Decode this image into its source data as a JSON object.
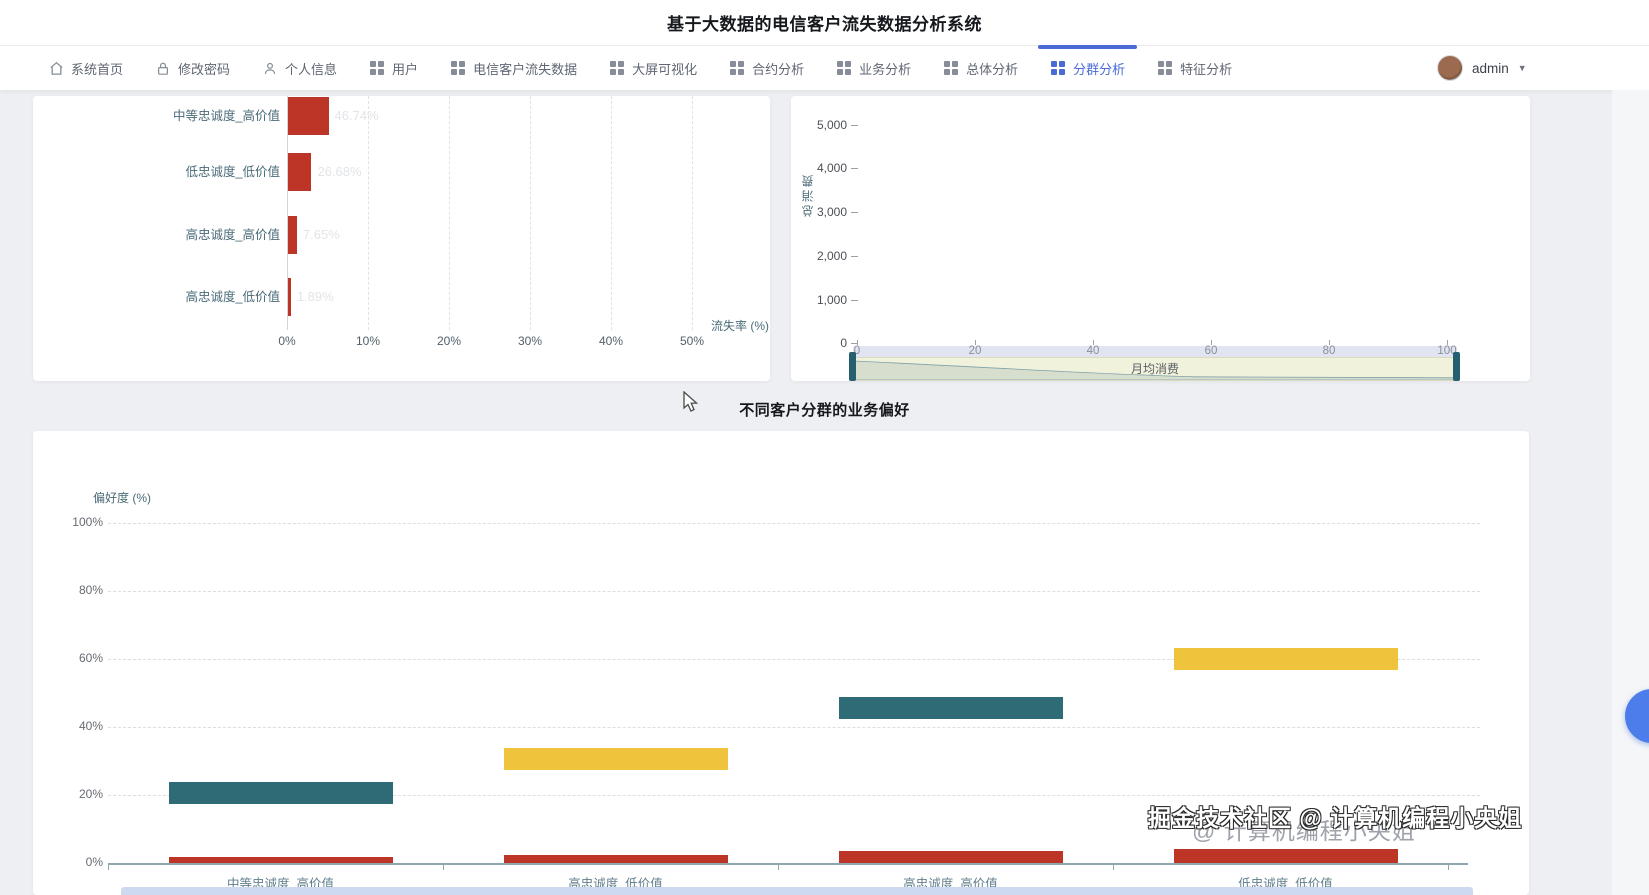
{
  "header": {
    "title": "基于大数据的电信客户流失数据分析系统"
  },
  "navbar": {
    "items": [
      {
        "id": "home",
        "label": "系统首页",
        "icon": "home",
        "active": false
      },
      {
        "id": "change-password",
        "label": "修改密码",
        "icon": "lock",
        "active": false
      },
      {
        "id": "profile",
        "label": "个人信息",
        "icon": "user",
        "active": false
      },
      {
        "id": "users",
        "label": "用户",
        "icon": "apps",
        "active": false
      },
      {
        "id": "telecom-churn-data",
        "label": "电信客户流失数据",
        "icon": "apps",
        "active": false
      },
      {
        "id": "big-screen",
        "label": "大屏可视化",
        "icon": "apps",
        "active": false
      },
      {
        "id": "contract-analysis",
        "label": "合约分析",
        "icon": "apps",
        "active": false
      },
      {
        "id": "business-analysis",
        "label": "业务分析",
        "icon": "apps",
        "active": false
      },
      {
        "id": "overall-analysis",
        "label": "总体分析",
        "icon": "apps",
        "active": false
      },
      {
        "id": "cluster-analysis",
        "label": "分群分析",
        "icon": "apps",
        "active": true
      },
      {
        "id": "feature-analysis",
        "label": "特征分析",
        "icon": "apps",
        "active": false
      }
    ],
    "user": {
      "name": "admin"
    }
  },
  "section_title": "不同客户分群的业务偏好",
  "watermark": {
    "front": "掘金技术社区 @ 计算机编程小央姐",
    "back": "@ 计算机编程小央姐"
  },
  "colors": {
    "accent_blue": "#4a6bd6",
    "bar_red": "#bd3526",
    "bar_teal": "#2f6a77",
    "bar_yellow": "#f0c33c",
    "slider_handle": "#25606e",
    "slider_body": "#f1f2dc",
    "slider_track": "#e0e4f3",
    "datazoom_strip": "#ccd9ee",
    "fab_blue": "#4c7dea"
  },
  "chart_data": [
    {
      "id": "churn-rate-by-segment",
      "type": "bar",
      "orientation": "horizontal",
      "categories": [
        "中等忠诚度_高价值",
        "低忠诚度_低价值",
        "高忠诚度_高价值",
        "高忠诚度_低价值"
      ],
      "values": [
        46.74,
        26.68,
        7.65,
        1.89
      ],
      "value_labels": [
        "46.74%",
        "26.68%",
        "7.65%",
        "1.89%"
      ],
      "displayed_bar_pct": [
        5.0,
        2.9,
        1.1,
        0.35
      ],
      "xlabel": "流失率 (%)",
      "x_ticks": [
        "0%",
        "10%",
        "20%",
        "30%",
        "40%",
        "50%"
      ],
      "xlim": [
        0,
        50
      ],
      "grid": true,
      "bar_color": "#bd3526"
    },
    {
      "id": "total-consumption-vs-monthly-spend",
      "type": "scatter",
      "ylabel": "总消费",
      "y_ticks": [
        "5,000",
        "4,000",
        "3,000",
        "2,000",
        "1,000",
        "0"
      ],
      "ylim": [
        0,
        5000
      ],
      "x_ticks": [
        "0",
        "20",
        "40",
        "60",
        "80",
        "100"
      ],
      "xlim": [
        0,
        100
      ],
      "points": [],
      "datazoom": {
        "label": "月均消费",
        "range": [
          0,
          100
        ]
      }
    },
    {
      "id": "segment-business-preference",
      "type": "bar",
      "title": "不同客户分群的业务偏好",
      "ylabel": "偏好度 (%)",
      "y_ticks": [
        "100%",
        "80%",
        "60%",
        "40%",
        "20%",
        "0%"
      ],
      "y_tick_pcts": [
        100,
        80,
        60,
        40,
        20,
        0
      ],
      "ylim": [
        0,
        100
      ],
      "grid": true,
      "categories": [
        "中等忠诚度_高价值",
        "高忠诚度_低价值",
        "高忠诚度_高价值",
        "低忠诚度_低价值"
      ],
      "segments": [
        {
          "category": "中等忠诚度_高价值",
          "color": "#2f6a77",
          "center_pct": 20.5,
          "span_pct": 6.5
        },
        {
          "category": "高忠诚度_低价值",
          "color": "#f0c33c",
          "center_pct": 30.5,
          "span_pct": 6.5
        },
        {
          "category": "高忠诚度_高价值",
          "color": "#2f6a77",
          "center_pct": 45.5,
          "span_pct": 6.5
        },
        {
          "category": "低忠诚度_低价值",
          "color": "#f0c33c",
          "center_pct": 60.0,
          "span_pct": 6.5
        }
      ],
      "baseline_bars": {
        "color": "#bd3526",
        "values_pct": [
          1.8,
          2.4,
          3.5,
          4.1
        ]
      }
    }
  ]
}
